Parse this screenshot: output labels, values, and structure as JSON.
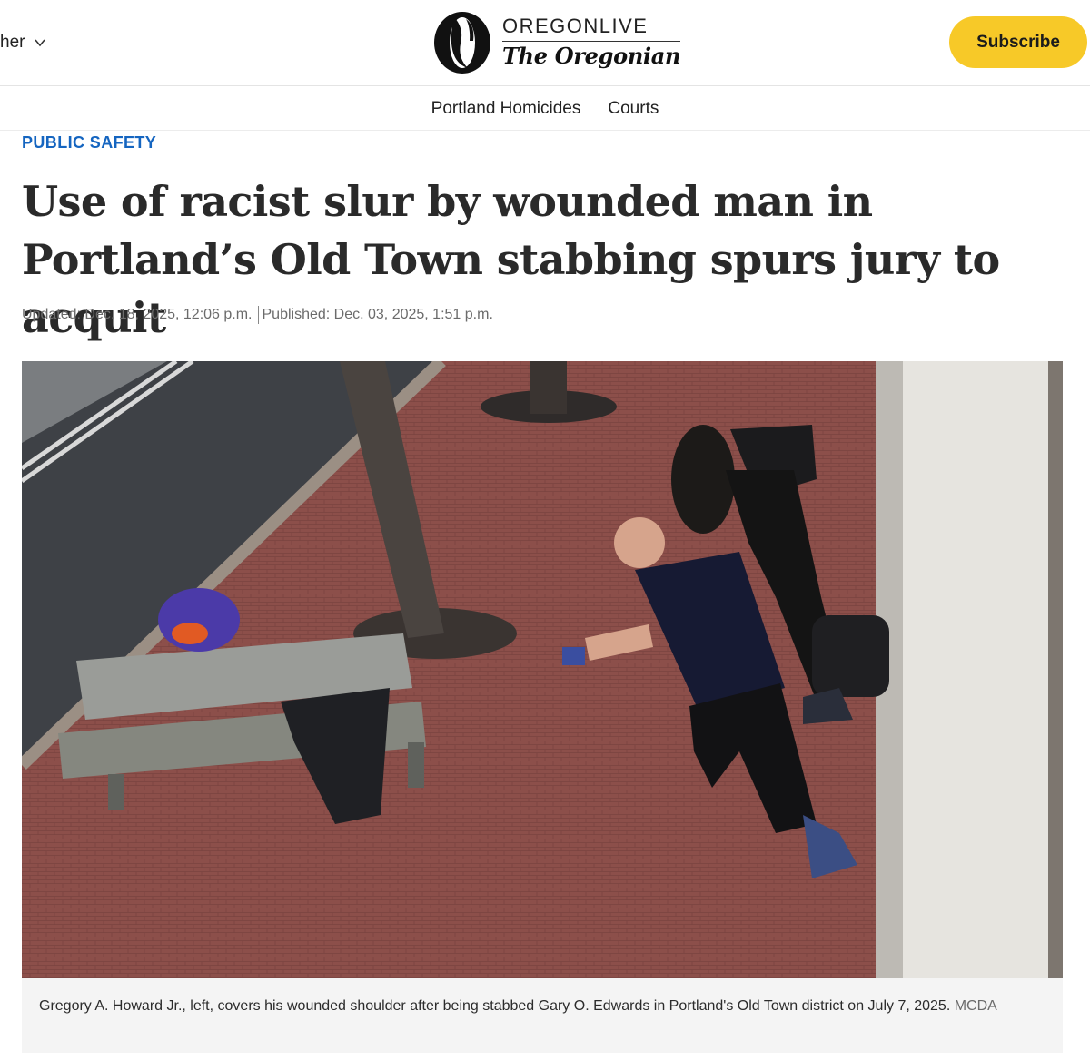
{
  "header": {
    "menu_label": "her",
    "brand_top": "OREGONLIVE",
    "brand_bottom": "The Oregonian",
    "subscribe_label": "Subscribe"
  },
  "nav": {
    "items": [
      {
        "label": "Portland Homicides"
      },
      {
        "label": "Courts"
      }
    ]
  },
  "article": {
    "section": "PUBLIC SAFETY",
    "headline": "Use of racist slur by wounded man in Portland’s Old Town stabbing spurs jury to acquit",
    "updated": "Updated: Dec. 18, 2025, 12:06 p.m.",
    "published": "Published: Dec. 03, 2025, 1:51 p.m.",
    "photo": {
      "caption": "Gregory A. Howard Jr., left, covers his wounded shoulder after being stabbed Gary O. Edwards in Portland's Old Town district on July 7, 2025.",
      "credit": "MCDA"
    }
  },
  "colors": {
    "accent_section": "#1565c0",
    "subscribe_bg": "#f7c928",
    "brick": "#8a4e49"
  }
}
